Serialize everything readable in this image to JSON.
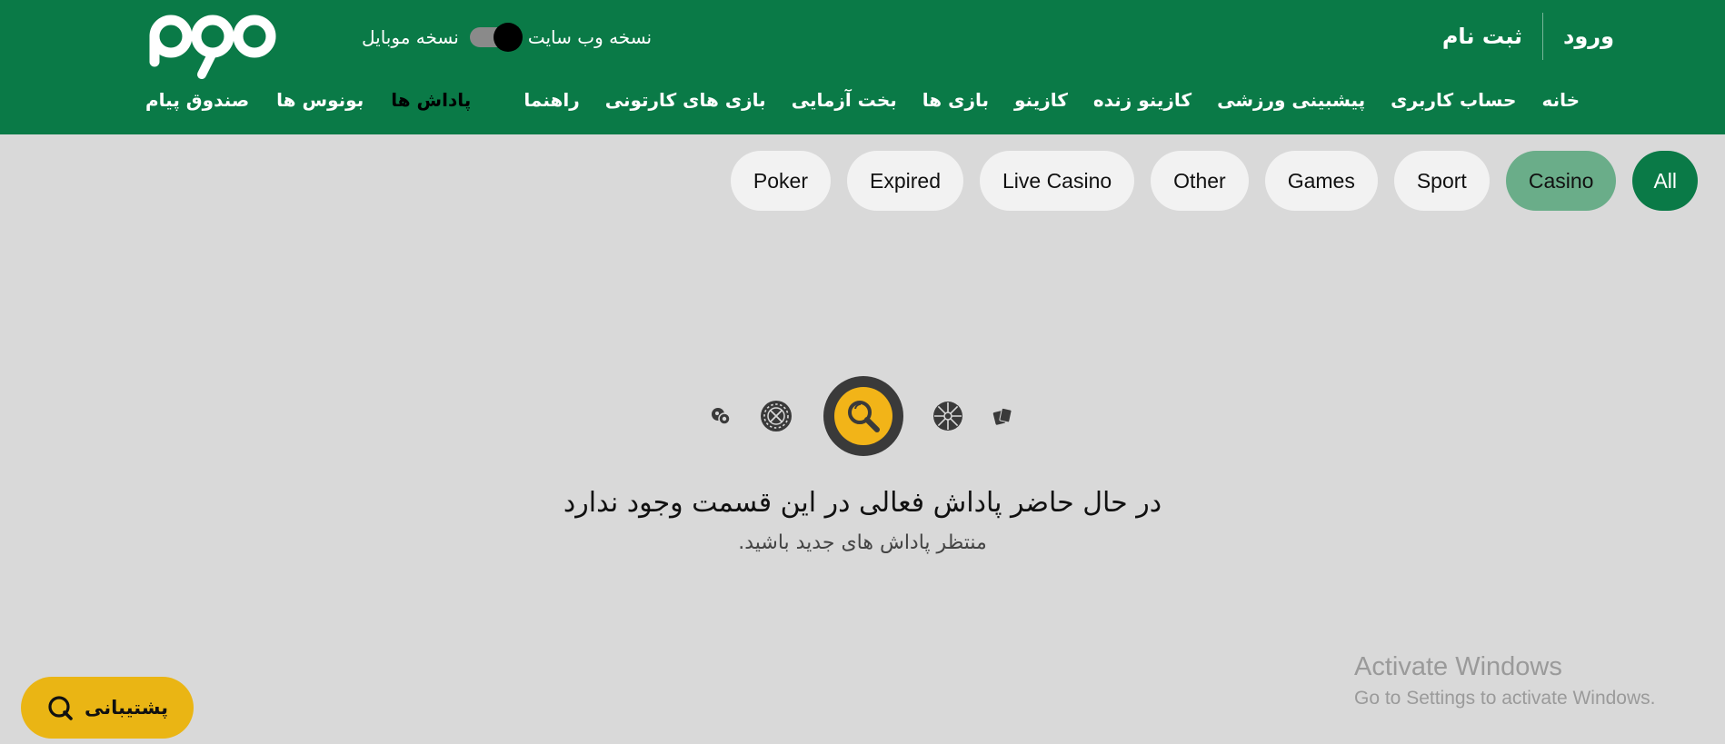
{
  "header": {
    "auth": {
      "login": "ورود",
      "register": "ثبت نام"
    },
    "version_toggle": {
      "web_label": "نسخه وب سایت",
      "mobile_label": "نسخه موبایل"
    },
    "nav_main": [
      "خانه",
      "حساب کاربری",
      "پیشبینی ورزشی",
      "کازینو زنده",
      "کازینو",
      "بازی ها",
      "بخت آزمایی",
      "بازی های کارتونی",
      "راهنما"
    ],
    "nav_extra": {
      "rewards": "پاداش ها",
      "bonuses": "بونوس ها",
      "inbox": "صندوق پیام"
    },
    "colors": {
      "brand": "#0a7a47",
      "accent": "#f2b418"
    }
  },
  "filters": {
    "chips": [
      "All",
      "Casino",
      "Sport",
      "Games",
      "Other",
      "Live Casino",
      "Expired",
      "Poker"
    ],
    "selected": "All",
    "highlighted": "Casino"
  },
  "empty_state": {
    "icons": [
      "balls-icon",
      "roulette-icon",
      "search-icon",
      "wheel-icon",
      "cards-icon"
    ],
    "title": "در حال حاضر پاداش فعالی در این قسمت وجود ندارد",
    "subtitle": "منتظر پاداش های جدید باشید."
  },
  "support": {
    "label": "پشتیبانی"
  },
  "watermark": {
    "title": "Activate Windows",
    "subtitle": "Go to Settings to activate Windows."
  }
}
